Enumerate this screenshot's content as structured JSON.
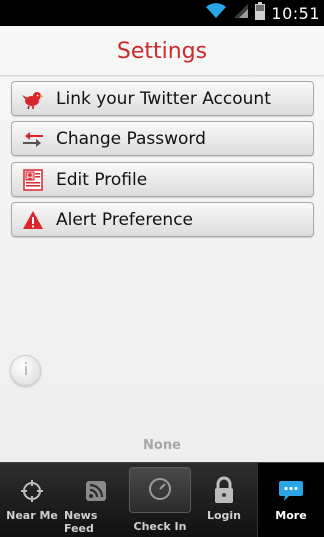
{
  "status_bar": {
    "time": "10:51",
    "icons": [
      "wifi-icon",
      "signal-icon",
      "battery-icon"
    ]
  },
  "header": {
    "title": "Settings"
  },
  "menu": {
    "items": [
      {
        "label": "Link your Twitter Account",
        "icon": "twitter-bird-icon"
      },
      {
        "label": "Change Password",
        "icon": "swap-arrows-icon"
      },
      {
        "label": "Edit Profile",
        "icon": "profile-card-icon"
      },
      {
        "label": "Alert Preference",
        "icon": "warning-icon"
      }
    ]
  },
  "content": {
    "empty_text": "None"
  },
  "tabbar": {
    "tabs": [
      {
        "label": "Near Me",
        "icon": "crosshair-icon"
      },
      {
        "label": "News Feed",
        "icon": "rss-icon"
      },
      {
        "label": "Check In",
        "icon": "clock-icon"
      },
      {
        "label": "Login",
        "icon": "lock-icon"
      },
      {
        "label": "More",
        "icon": "chat-bubble-icon",
        "active": true
      }
    ]
  },
  "colors": {
    "title": "#cc2a2a",
    "accent_blue": "#2aa5e6",
    "tabbar": "#1e1e1e"
  }
}
